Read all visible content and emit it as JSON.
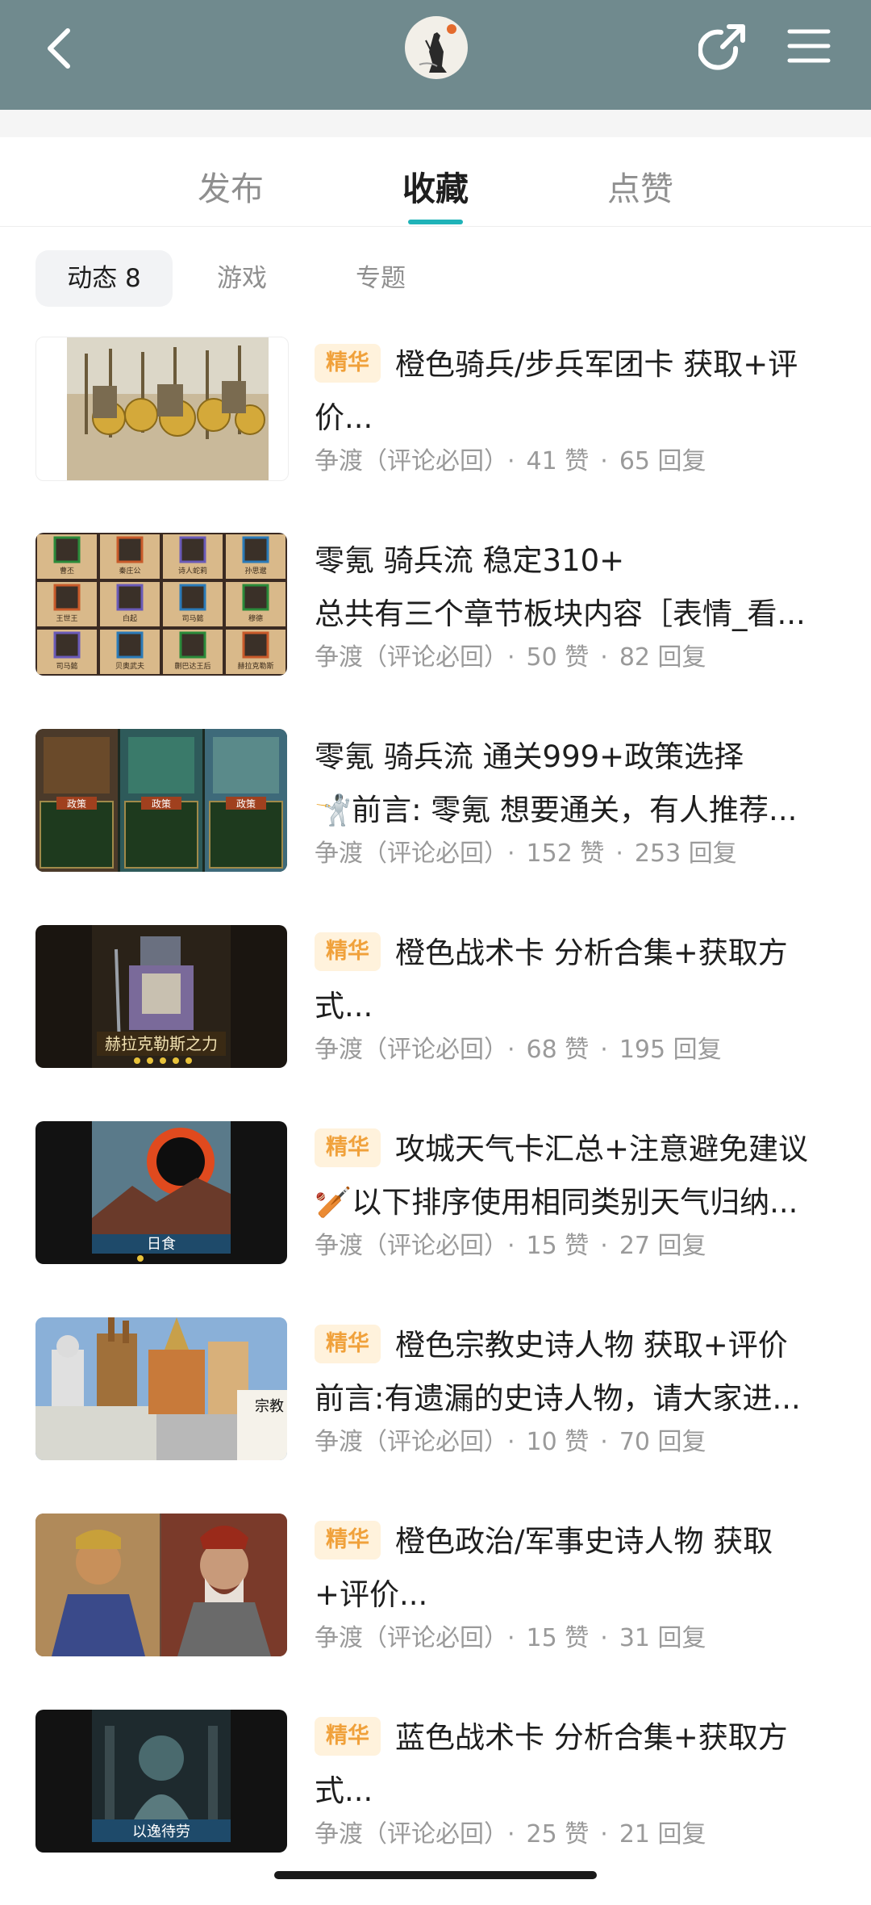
{
  "tabs": [
    {
      "label": "发布",
      "active": false
    },
    {
      "label": "收藏",
      "active": true
    },
    {
      "label": "点赞",
      "active": false
    }
  ],
  "subtabs": [
    {
      "label": "动态 8",
      "active": true
    },
    {
      "label": "游戏",
      "active": false
    },
    {
      "label": "专题",
      "active": false
    }
  ],
  "posts": [
    {
      "badge": "精华",
      "title": "橙色骑兵/步兵军团卡 获取+评",
      "line2": "价...",
      "author": "争渡（评论必回）",
      "likes": "41 赞",
      "replies": "65 回复"
    },
    {
      "badge": "",
      "title": "零氪 骑兵流 稳定310+",
      "line2": "总共有三个章节板块内容［表情_看...",
      "author": "争渡（评论必回）",
      "likes": "50 赞",
      "replies": "82 回复"
    },
    {
      "badge": "",
      "title": "零氪 骑兵流 通关999+政策选择",
      "line2": "🤺前言: 零氪 想要通关，有人推荐...",
      "author": "争渡（评论必回）",
      "likes": "152 赞",
      "replies": "253 回复"
    },
    {
      "badge": "精华",
      "title": "橙色战术卡 分析合集+获取方",
      "line2": "式...",
      "author": "争渡（评论必回）",
      "likes": "68 赞",
      "replies": "195 回复"
    },
    {
      "badge": "精华",
      "title": "攻城天气卡汇总+注意避免建议",
      "line2": "🏏以下排序使用相同类别天气归纳...",
      "author": "争渡（评论必回）",
      "likes": "15 赞",
      "replies": "27 回复"
    },
    {
      "badge": "精华",
      "title": "橙色宗教史诗人物 获取+评价",
      "line2": "前言:有遗漏的史诗人物，请大家进...",
      "author": "争渡（评论必回）",
      "likes": "10 赞",
      "replies": "70 回复"
    },
    {
      "badge": "精华",
      "title": "橙色政治/军事史诗人物 获取",
      "line2": "+评价...",
      "author": "争渡（评论必回）",
      "likes": "15 赞",
      "replies": "31 回复"
    },
    {
      "badge": "精华",
      "title": "蓝色战术卡 分析合集+获取方",
      "line2": "式...",
      "author": "争渡（评论必回）",
      "likes": "25 赞",
      "replies": "21 回复"
    }
  ],
  "thumb_captions": {
    "p4": "赫拉克勒斯之力",
    "p5": "日食",
    "p6": "宗教",
    "p8": "以逸待劳",
    "p3_labels": [
      "政策",
      "政策",
      "政策"
    ],
    "p2_labels": [
      "曹丕",
      "秦庄公",
      "诗人蛇莉",
      "孙思邈",
      "王世王",
      "白起",
      "司马懿",
      "穆德",
      "司马懿",
      "贝奥武夫",
      "蒯巴达王后",
      "赫拉克勒斯"
    ]
  },
  "separator": "·"
}
